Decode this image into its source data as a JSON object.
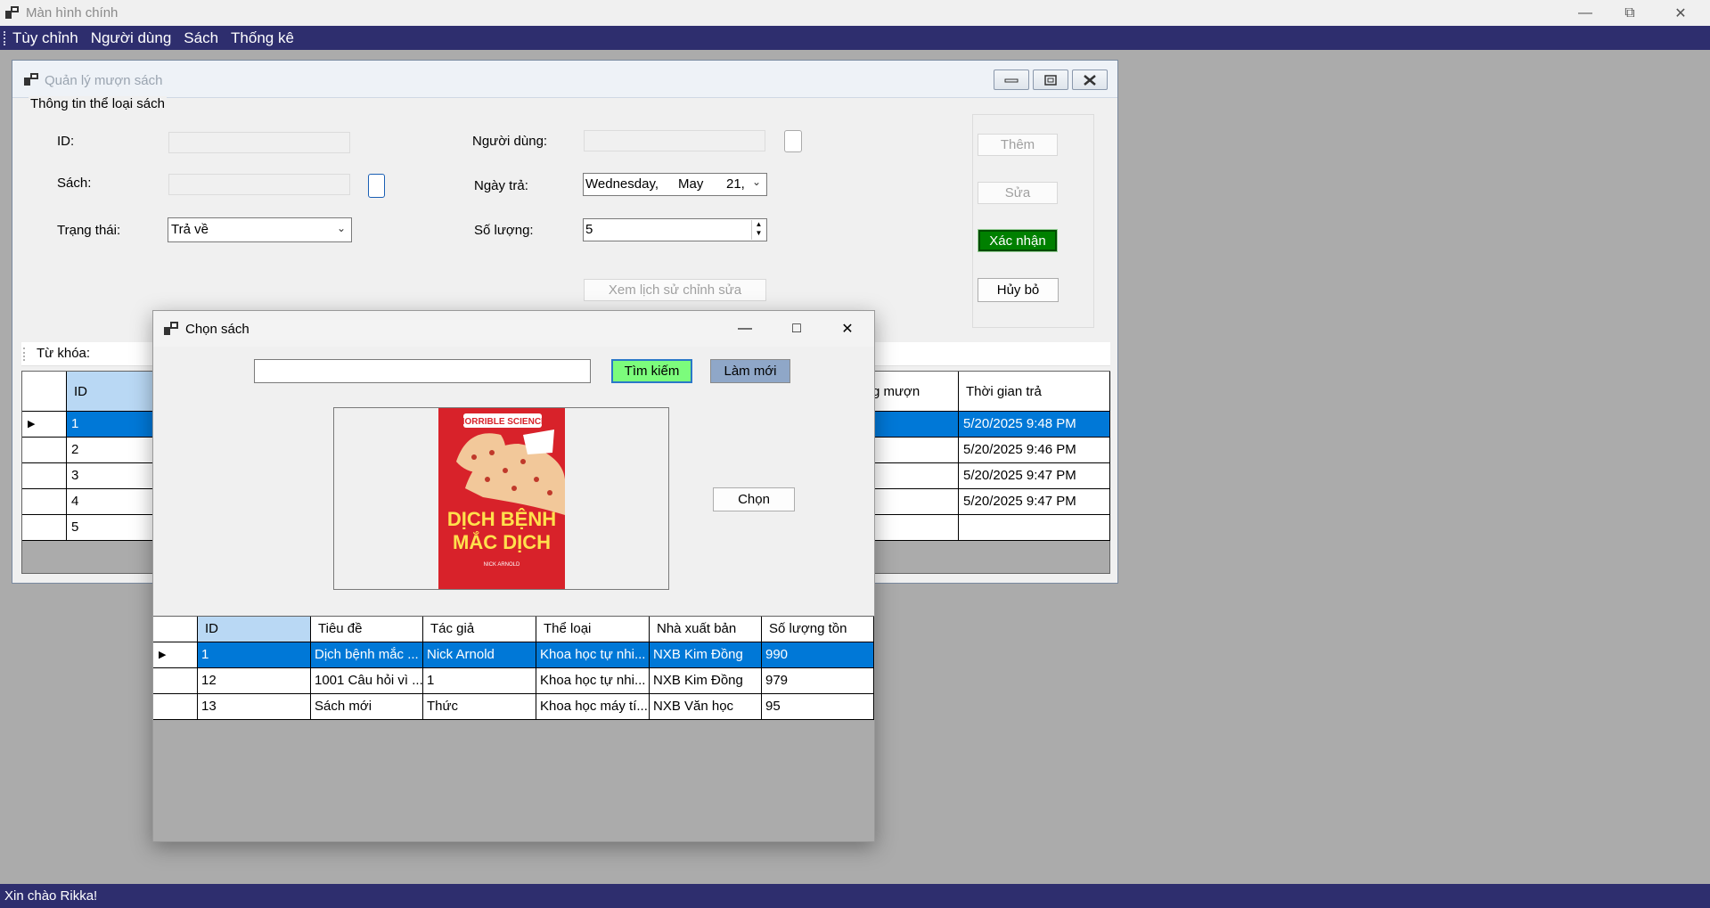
{
  "main_window": {
    "title": "Màn hình chính"
  },
  "menu": {
    "items": [
      "Tùy chỉnh",
      "Người dùng",
      "Sách",
      "Thống kê"
    ]
  },
  "child_window": {
    "title": "Quản lý mượn sách",
    "group_title": "Thông tin thể loại sách",
    "labels": {
      "id": "ID:",
      "book": "Sách:",
      "status": "Trạng thái:",
      "user": "Người dùng:",
      "return_date": "Ngày trả:",
      "quantity": "Số lượng:"
    },
    "status_value": "Trả về",
    "date_value": {
      "weekday": "Wednesday,",
      "month": "May",
      "day": "21,"
    },
    "quantity_value": "5",
    "history_button": "Xem lịch sử chỉnh sửa",
    "buttons": {
      "add": "Thêm",
      "edit": "Sửa",
      "confirm": "Xác nhận",
      "cancel": "Hủy bỏ"
    },
    "keyword_label": "Từ khóa:",
    "grid": {
      "headers": {
        "id": "ID",
        "borrow": "g mượn",
        "return_time": "Thời gian trả"
      },
      "rows": [
        {
          "id": "1",
          "return_time": "5/20/2025 9:48 PM"
        },
        {
          "id": "2",
          "return_time": "5/20/2025 9:46 PM"
        },
        {
          "id": "3",
          "return_time": "5/20/2025 9:47 PM"
        },
        {
          "id": "4",
          "return_time": "5/20/2025 9:47 PM"
        },
        {
          "id": "5",
          "return_time": ""
        }
      ]
    }
  },
  "dialog": {
    "title": "Chọn sách",
    "search_placeholder": "",
    "search_button": "Tìm kiếm",
    "refresh_button": "Làm mới",
    "choose_button": "Chọn",
    "cover": {
      "series": "HORRIBLE SCIENCE",
      "title_line1": "DỊCH BỆNH",
      "title_line2": "MẮC DỊCH",
      "author": "NICK ARNOLD"
    },
    "grid": {
      "headers": [
        "ID",
        "Tiêu đề",
        "Tác giả",
        "Thể loại",
        "Nhà xuất bản",
        "Số lượng tồn"
      ],
      "rows": [
        [
          "1",
          "Dịch bệnh mắc ...",
          "Nick Arnold",
          "Khoa học tự nhi...",
          "NXB Kim Đồng",
          "990"
        ],
        [
          "12",
          "1001 Câu hỏi vì ...",
          "1",
          "Khoa học tự nhi...",
          "NXB Kim Đồng",
          "979"
        ],
        [
          "13",
          "Sách mới",
          "Thức",
          "Khoa học máy tí...",
          "NXB Văn học",
          "95"
        ]
      ]
    }
  },
  "status_bar": {
    "text": "Xin chào Rikka!"
  },
  "colors": {
    "menu_bg": "#2e2e6e",
    "selection": "#0078d7",
    "confirm_green": "#008000",
    "search_green": "#7cfc7c",
    "refresh_blue": "#8fa7c8"
  }
}
